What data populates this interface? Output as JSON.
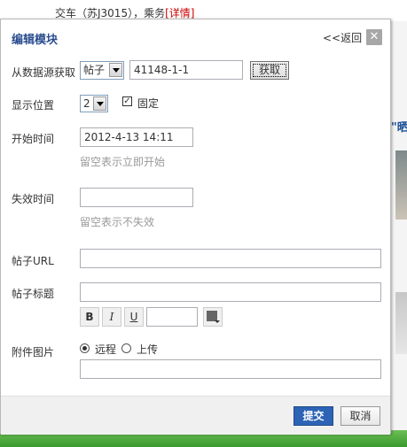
{
  "background": {
    "top_text": "交车（苏J3015），乘务",
    "top_link": "[详情]",
    "right_title": "\"晒"
  },
  "dialog": {
    "title": "编辑模块",
    "back_link": "<<返回",
    "close_glyph": "✕",
    "fields": {
      "source_label": "从数据源获取",
      "source_type": "帖子",
      "source_id": "41148-1-1",
      "fetch_button": "获取",
      "position_label": "显示位置",
      "position_value": "2",
      "fixed_label": "固定",
      "fixed_checked": "✓",
      "start_label": "开始时间",
      "start_value": "2012-4-13 14:11",
      "start_hint": "留空表示立即开始",
      "expire_label": "失效时间",
      "expire_value": "",
      "expire_hint": "留空表示不失效",
      "url_label": "帖子URL",
      "url_value": "",
      "title_label": "帖子标题",
      "title_value": "",
      "bold": "B",
      "italic": "I",
      "underline": "U",
      "font_size_value": "",
      "attach_label": "附件图片",
      "remote_label": "远程",
      "upload_label": "上传",
      "attach_value": ""
    },
    "footer": {
      "submit": "提交",
      "cancel": "取消"
    }
  },
  "colors": {
    "title": "#2a4d8f",
    "submit_bg": "#2d63b5",
    "hint": "#999999",
    "green_bar": "#3a9a2d"
  }
}
